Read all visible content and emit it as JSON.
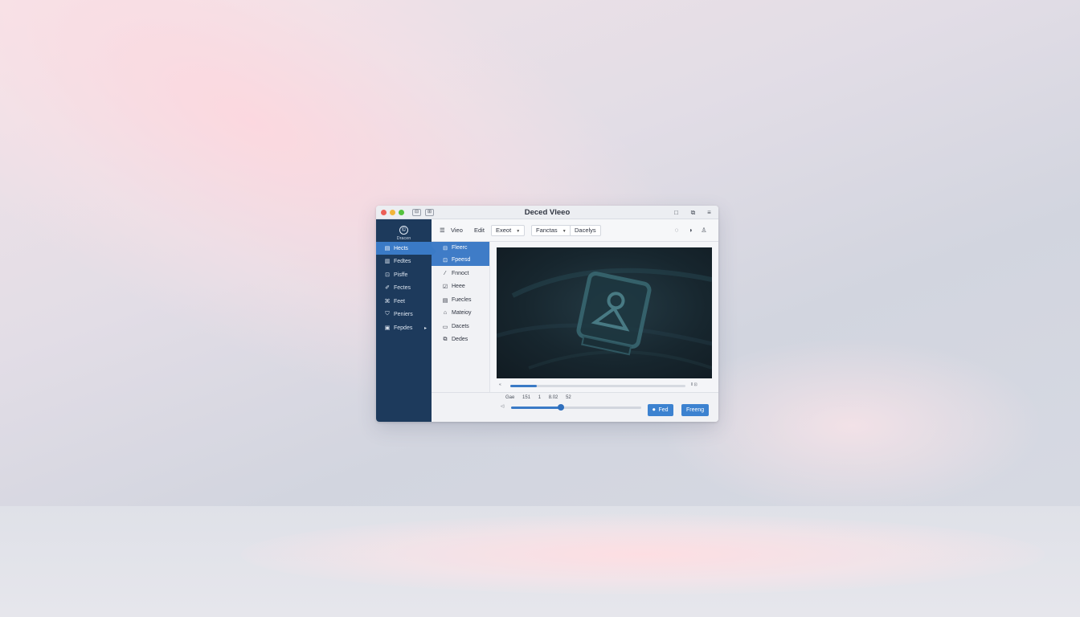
{
  "window": {
    "title": "Deced Vleeo",
    "titlebar_left_icons": [
      "⊟",
      "⊞"
    ],
    "titlebar_right_icons": [
      "□",
      "⧉",
      "≡"
    ]
  },
  "sidebar": {
    "brand_icon": "©",
    "brand_label": "Dracen",
    "items": [
      {
        "icon": "▤",
        "label": "Hects",
        "active": true
      },
      {
        "icon": "▥",
        "label": "Fedtes",
        "active": false
      },
      {
        "icon": "⊡",
        "label": "Pisffe",
        "active": false
      },
      {
        "icon": "✐",
        "label": "Fectes",
        "active": false
      },
      {
        "icon": "⌘",
        "label": "Feet",
        "active": false
      },
      {
        "icon": "⛉",
        "label": "Peniers",
        "active": false
      },
      {
        "icon": "▣",
        "label": "Fepdes",
        "active": false,
        "has_chevron": true
      }
    ]
  },
  "toolbar": {
    "view_icon": "☰",
    "view_label": "Vieo",
    "edit_label": "Edit",
    "export_label": "Exeot",
    "caretaker_label": "Fanctas",
    "display_label": "Dacelys",
    "right_icons": [
      "◌",
      "◑",
      "♙"
    ]
  },
  "subpanel": {
    "items": [
      {
        "icon": "⊟",
        "label": "Fleerc",
        "active": true
      },
      {
        "icon": "⊡",
        "label": "Fpeesd",
        "active": true
      },
      {
        "icon": "⁄",
        "label": "Fnnoct",
        "active": false
      },
      {
        "icon": "☑",
        "label": "Heee",
        "active": false
      },
      {
        "icon": "▤",
        "label": "Fuecles",
        "active": false
      },
      {
        "icon": "⌂",
        "label": "Mateioy",
        "active": false
      },
      {
        "icon": "▭",
        "label": "Dacets",
        "active": false
      },
      {
        "icon": "⧉",
        "label": "Dedes",
        "active": false
      }
    ]
  },
  "player": {
    "scrub_left": "«",
    "scrub_right": "‖ ⊡",
    "scrub_progress": 0.15,
    "time_labels": [
      "Gae",
      "151",
      "1",
      "8.02",
      "52"
    ],
    "volume_label": "◁",
    "volume_level": 0.38,
    "primary_button_icon": "⏺",
    "primary_button_label": "Fed",
    "secondary_button_label": "Freeng"
  },
  "colors": {
    "sidebar_bg": "#1d3a5c",
    "accent": "#3a7ac6",
    "video_bg": "#17262e"
  }
}
